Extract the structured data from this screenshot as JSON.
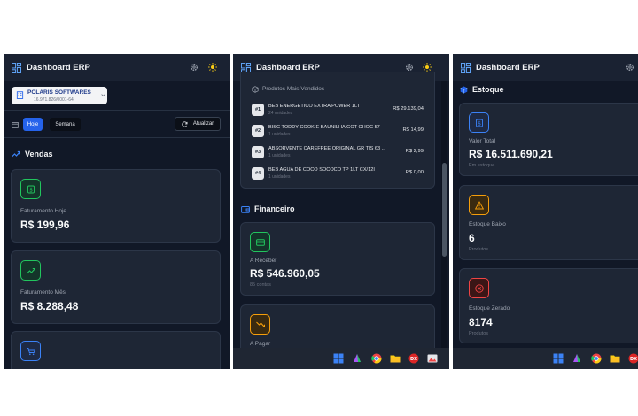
{
  "app": {
    "title": "Dashboard ERP"
  },
  "panel1": {
    "company": {
      "name": "POLARIS SOFTWARES",
      "cnpj": "16.971.826/0001-64"
    },
    "filters": {
      "today": "Hoje",
      "week": "Semana",
      "refresh": "Atualizar"
    },
    "section": "Vendas",
    "cards": [
      {
        "label": "Faturamento Hoje",
        "value": "R$ 199,96"
      },
      {
        "label": "Faturamento Mês",
        "value": "R$ 8.288,48"
      }
    ]
  },
  "panel2": {
    "top_products": {
      "title": "Produtos Mais Vendidos",
      "items": [
        {
          "rank": "#1",
          "name": "BEB ENERGETICO EXTRA POWER 1LT",
          "qty": "24 unidades",
          "value": "R$ 29.139,04"
        },
        {
          "rank": "#2",
          "name": "BISC TODDY COOKIE BAUNILHA GOT CHOC 57",
          "qty": "1 unidades",
          "value": "R$ 14,99"
        },
        {
          "rank": "#3",
          "name": "ABSORVENTE CAREFREE ORIGINAL GR TIS 63 ...",
          "qty": "1 unidades",
          "value": "R$ 2,99"
        },
        {
          "rank": "#4",
          "name": "BEB AGUA DE COCO SOCOCO TP 1LT CX/12I",
          "qty": "1 unidades",
          "value": "R$ 0,00"
        }
      ]
    },
    "section": "Financeiro",
    "cards": [
      {
        "label": "A Receber",
        "value": "R$ 546.960,05",
        "sub": "85 contas"
      },
      {
        "label": "A Pagar"
      }
    ]
  },
  "panel3": {
    "section": "Estoque",
    "cards": [
      {
        "label": "Valor Total",
        "value": "R$ 16.511.690,21",
        "sub": "Em estoque"
      },
      {
        "label": "Estoque Baixo",
        "value": "6",
        "sub": "Produtos"
      },
      {
        "label": "Estoque Zerado",
        "value": "8174",
        "sub": "Produtos"
      }
    ]
  },
  "colors": {
    "bg": "#111827",
    "card": "#1e2635",
    "accent": "#2563eb",
    "green": "#22c55e",
    "amber": "#f59e0b",
    "red": "#ef4444",
    "yellow": "#facc15"
  }
}
